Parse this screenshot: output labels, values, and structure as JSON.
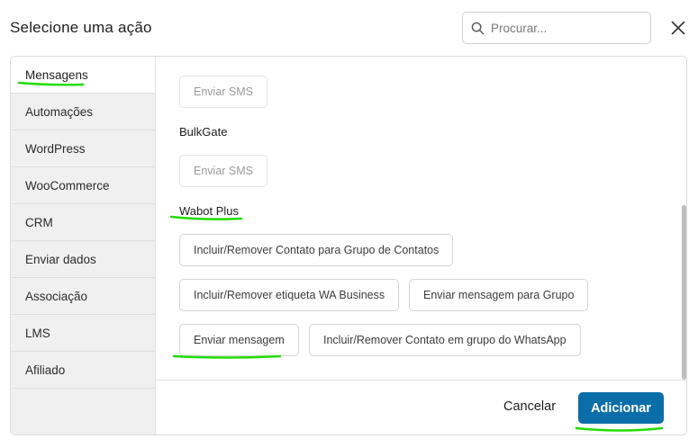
{
  "dialog": {
    "title": "Selecione uma ação",
    "search_placeholder": "Procurar..."
  },
  "sidebar": {
    "items": [
      {
        "label": "Mensagens",
        "active": true
      },
      {
        "label": "Automações"
      },
      {
        "label": "WordPress"
      },
      {
        "label": "WooCommerce"
      },
      {
        "label": "CRM"
      },
      {
        "label": "Enviar dados"
      },
      {
        "label": "Associação"
      },
      {
        "label": "LMS"
      },
      {
        "label": "Afiliado"
      }
    ]
  },
  "content": {
    "top_action": "Enviar SMS",
    "groups": [
      {
        "label": "BulkGate",
        "actions": [
          "Enviar SMS"
        ]
      },
      {
        "label": "Wabot Plus",
        "actions": [
          "Incluir/Remover Contato para Grupo de Contatos",
          "Incluir/Remover etiqueta WA Business",
          "Enviar mensagem para Grupo",
          "Enviar mensagem",
          "Incluir/Remover Contato em grupo do WhatsApp"
        ]
      }
    ]
  },
  "footer": {
    "cancel_label": "Cancelar",
    "add_label": "Adicionar"
  },
  "colors": {
    "primary": "#0b6ea9",
    "annotation": "#22dd00",
    "sidebar_bg": "#f0f0f1"
  }
}
